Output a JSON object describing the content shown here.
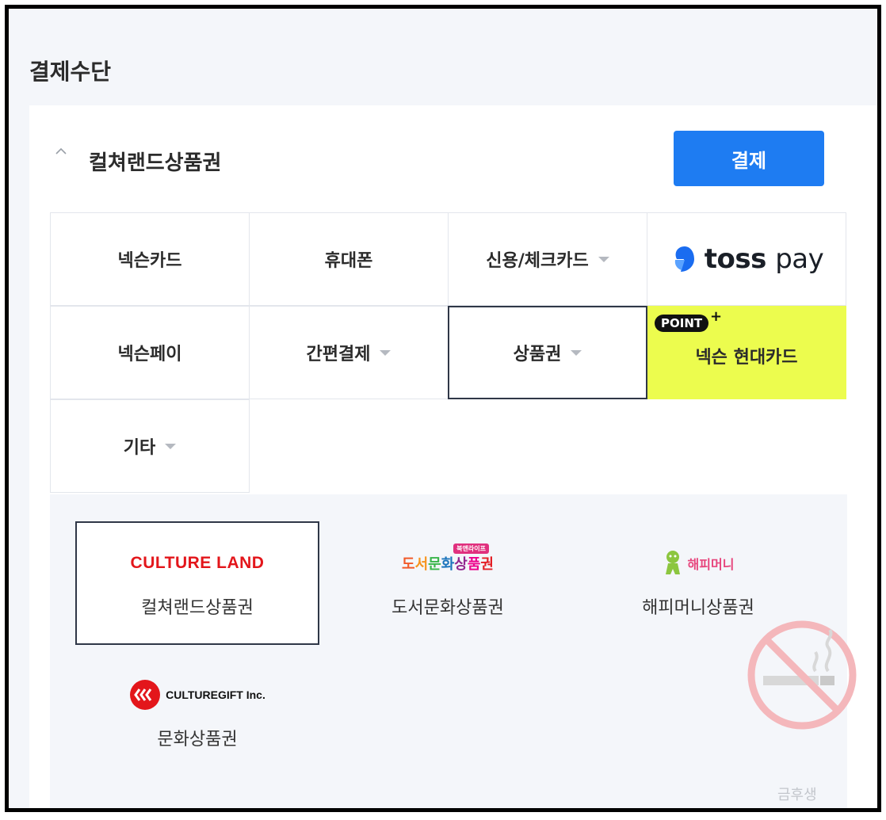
{
  "section_title": "결제수단",
  "accordion": {
    "title": "컬쳐랜드상품권",
    "chevron": "chevron-up-icon"
  },
  "pay_button_label": "결제",
  "methods": [
    {
      "label": "넥슨카드",
      "dropdown": false
    },
    {
      "label": "휴대폰",
      "dropdown": false
    },
    {
      "label": "신용/체크카드",
      "dropdown": true
    },
    {
      "label": "toss pay",
      "logo": "toss-pay-logo"
    },
    {
      "label": "넥슨페이",
      "dropdown": false
    },
    {
      "label": "간편결제",
      "dropdown": true
    },
    {
      "label": "상품권",
      "dropdown": true,
      "selected": true
    },
    {
      "label": "넥슨 현대카드",
      "badge": "POINT",
      "badge_suffix": "+",
      "highlight": "#ecfc4e"
    },
    {
      "label": "기타",
      "dropdown": true
    }
  ],
  "toss": {
    "bold": "toss",
    "light": "pay"
  },
  "vouchers": [
    {
      "name": "컬쳐랜드상품권",
      "logo_text": "CULTURE LAND",
      "selected": true
    },
    {
      "name": "도서문화상품권",
      "logo_text": "도서문화상품권",
      "logo_tag": "북앤라이프"
    },
    {
      "name": "해피머니상품권",
      "logo_text": "해피머니"
    },
    {
      "name": "문화상품권",
      "logo_text": "CULTUREGIFT Inc."
    }
  ],
  "watermark": {
    "icon": "no-smoking-icon",
    "text": "금후생"
  },
  "colors": {
    "accent": "#1e7cf2",
    "promo": "#ecfc4e",
    "culture_land_red": "#e3161b"
  }
}
